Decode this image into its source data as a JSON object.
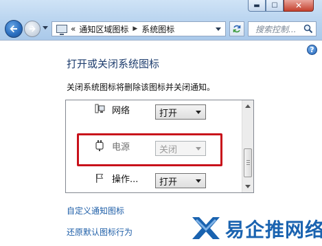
{
  "window": {
    "caption_buttons": {
      "minimize_symbol": "▬",
      "maximize_symbol": "☐",
      "close_symbol": "✕"
    },
    "colors": {
      "titlebar": "#bcd6f0",
      "close_button": "#c4402d",
      "link": "#1f5fa8",
      "title_text": "#1e3d6e",
      "highlight_box": "#c8101a"
    }
  },
  "toolbar": {
    "back_icon": "back-arrow-icon",
    "forward_icon": "forward-arrow-icon",
    "address": {
      "prefix": "«",
      "breadcrumbs": [
        "通知区域图标",
        "系统图标"
      ],
      "separator": "▶"
    },
    "search": {
      "placeholder": "搜索控制..."
    }
  },
  "main": {
    "title": "打开或关闭系统图标",
    "description": "关闭系统图标将删除该图标并关闭通知。",
    "rows": [
      {
        "name": "网络",
        "icon": "network-icon",
        "value": "打开",
        "enabled": true
      },
      {
        "name": "电源",
        "icon": "power-plug-icon",
        "value": "关闭",
        "enabled": false
      },
      {
        "name": "操作...",
        "icon": "action-center-flag-icon",
        "value": "打开",
        "enabled": true
      }
    ],
    "links": {
      "customize": "自定义通知图标",
      "restore": "还原默认图标行为"
    }
  },
  "watermark": {
    "text": "易企推网络"
  }
}
